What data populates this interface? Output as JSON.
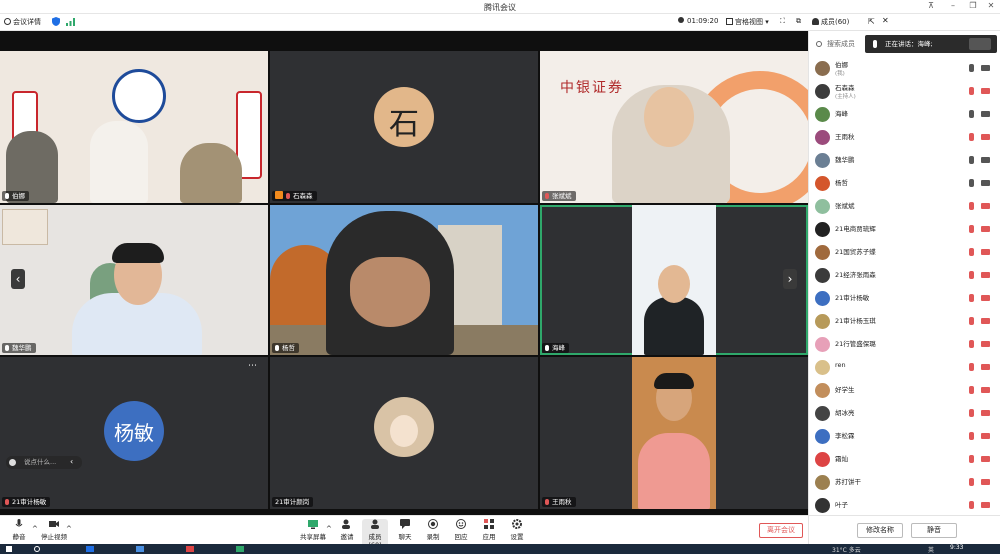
{
  "window": {
    "title": "腾讯会议"
  },
  "topbar": {
    "meeting_details": "会议详情",
    "timer": "01:09:20",
    "gallery_view": "宫格视图",
    "members_label": "成员(60)"
  },
  "tiles": [
    {
      "name": "伯娜",
      "mic": "on",
      "host": false,
      "text": "",
      "colors": {
        "bg": "#efe8e0",
        "accent": "#c8262c"
      }
    },
    {
      "name": "石森森",
      "mic": "off",
      "host": true,
      "text": "",
      "colors": {
        "bg": "#2f3033",
        "accent": "#e2b78a"
      }
    },
    {
      "name": "张斌斌",
      "mic": "off",
      "host": false,
      "text": "中银证券",
      "colors": {
        "bg": "#f3eee9",
        "accent": "#b02a2a"
      }
    },
    {
      "name": "魏华鹏",
      "mic": "on",
      "host": false,
      "text": "",
      "colors": {
        "bg": "#e7e4e1",
        "accent": "#1f3a66"
      }
    },
    {
      "name": "杨哲",
      "mic": "on",
      "host": false,
      "text": "",
      "colors": {
        "bg": "#6fa3d6",
        "accent": "#2a2a2a"
      }
    },
    {
      "name": "海峰",
      "mic": "on",
      "host": false,
      "text": "",
      "colors": {
        "bg": "#2f3033",
        "accent": "#eef2f5"
      }
    },
    {
      "name": "21审计杨敏",
      "mic": "off",
      "host": false,
      "text": "杨敏",
      "colors": {
        "bg": "#2f3033",
        "accent": "#3d6fc1"
      }
    },
    {
      "name": "21审计颜岗",
      "mic": "none",
      "host": false,
      "text": "",
      "colors": {
        "bg": "#2f3033",
        "accent": "#d9c3a6"
      }
    },
    {
      "name": "王雨秋",
      "mic": "off",
      "host": false,
      "text": "",
      "colors": {
        "bg": "#2f3033",
        "accent": "#c98a4e"
      }
    }
  ],
  "chat_placeholder": "说点什么...",
  "toolbar": {
    "mute": "静音",
    "stop_video": "停止视频",
    "share_screen": "共享屏幕",
    "invite": "邀请",
    "members": "成员(60)",
    "chat": "聊天",
    "record": "录制",
    "reactions": "回应",
    "apps": "应用",
    "settings": "设置",
    "leave": "离开会议"
  },
  "panel": {
    "search_placeholder": "搜索成员",
    "speaking_prefix": "正在讲话：",
    "speaking_name": "海峰;",
    "rename_button": "修改名称",
    "mute_button": "静音",
    "participants": [
      {
        "name": "伯娜",
        "sub": "(我)",
        "mic": "on",
        "color": "#8a6d4f"
      },
      {
        "name": "石森森",
        "sub": "(主持人)",
        "mic": "off",
        "color": "#3c3c3c"
      },
      {
        "name": "海峰",
        "sub": "",
        "mic": "on",
        "color": "#5a8a4a"
      },
      {
        "name": "王雨秋",
        "sub": "",
        "mic": "off",
        "color": "#9b4b7c"
      },
      {
        "name": "魏华鹏",
        "sub": "",
        "mic": "on",
        "color": "#6b7f94"
      },
      {
        "name": "杨哲",
        "sub": "",
        "mic": "on",
        "color": "#d4562c"
      },
      {
        "name": "张斌斌",
        "sub": "",
        "mic": "off",
        "color": "#8fbf9e"
      },
      {
        "name": "21电商贾琉辉",
        "sub": "",
        "mic": "off",
        "color": "#222222"
      },
      {
        "name": "21国贸苏子蝶",
        "sub": "",
        "mic": "off",
        "color": "#a06a3d"
      },
      {
        "name": "21经济张雨森",
        "sub": "",
        "mic": "off",
        "color": "#3b3b3b"
      },
      {
        "name": "21审计杨敏",
        "sub": "",
        "mic": "off",
        "color": "#3d6fc1"
      },
      {
        "name": "21审计杨玉琪",
        "sub": "",
        "mic": "off",
        "color": "#b79a5a"
      },
      {
        "name": "21行管盛保璐",
        "sub": "",
        "mic": "off",
        "color": "#e7a0b8"
      },
      {
        "name": "ren",
        "sub": "",
        "mic": "off",
        "color": "#d9c08a"
      },
      {
        "name": "好学生",
        "sub": "",
        "mic": "off",
        "color": "#c28e5c"
      },
      {
        "name": "胡冰亮",
        "sub": "",
        "mic": "off",
        "color": "#444444"
      },
      {
        "name": "李松霖",
        "sub": "",
        "mic": "off",
        "color": "#3d6fc1"
      },
      {
        "name": "霜灿",
        "sub": "",
        "mic": "off",
        "color": "#d44"
      },
      {
        "name": "苏打饼干",
        "sub": "",
        "mic": "off",
        "color": "#9c8050"
      },
      {
        "name": "叶子",
        "sub": "",
        "mic": "off",
        "color": "#333333"
      }
    ]
  },
  "taskbar": {
    "time": "9:33",
    "weather": "31°C 多云",
    "lang": "英"
  },
  "colors": {
    "accent_green": "#2fa86b",
    "danger": "#e05757",
    "brand_blue": "#1f6fe5"
  }
}
